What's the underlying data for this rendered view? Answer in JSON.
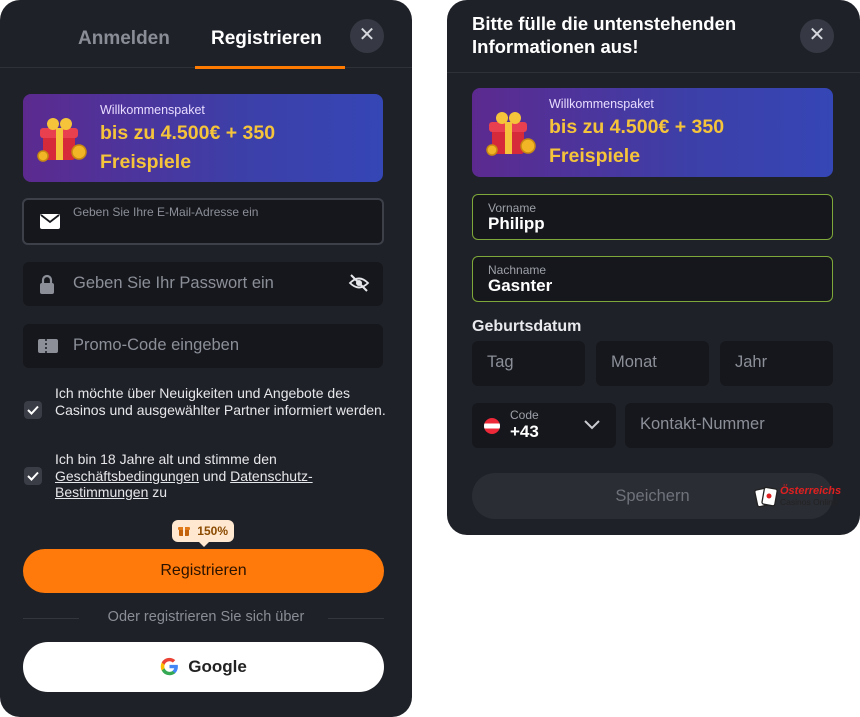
{
  "login_panel": {
    "tabs": {
      "login": "Anmelden",
      "register": "Registrieren"
    },
    "close": "✕",
    "promo": {
      "small": "Willkommenspaket",
      "big": "bis zu 4.500€ + 350 Freispiele"
    },
    "email": {
      "placeholder": "Geben Sie Ihre E-Mail-Adresse ein"
    },
    "password": {
      "placeholder": "Geben Sie Ihr Passwort ein"
    },
    "promo_code": {
      "placeholder": "Promo-Code eingeben"
    },
    "checkbox_news": {
      "label": "Ich möchte über Neuigkeiten und Angebote des Casinos und ausgewählter Partner informiert werden.",
      "checked": true
    },
    "checkbox_terms": {
      "prefix": "Ich bin 18 Jahre alt und stimme den ",
      "link1": "Geschäftsbedingungen",
      "middle": " und ",
      "link2": "Datenschutz-Bestimmungen",
      "suffix": " zu",
      "checked": true
    },
    "bonus_badge": "150%",
    "register_button": "Registrieren",
    "divider": "Oder registrieren Sie sich über",
    "google_button": "Google"
  },
  "details_panel": {
    "title": "Bitte fülle die untenstehenden Informationen aus!",
    "close": "✕",
    "promo": {
      "small": "Willkommenspaket",
      "big": "bis zu 4.500€ + 350 Freispiele"
    },
    "first_name": {
      "label": "Vorname",
      "value": "Philipp"
    },
    "last_name": {
      "label": "Nachname",
      "value": "Gasnter"
    },
    "birthdate": {
      "label": "Geburtsdatum",
      "day": "Tag",
      "month": "Monat",
      "year": "Jahr"
    },
    "phone": {
      "code_label": "Code",
      "code_value": "+43",
      "placeholder": "Kontakt-Nummer"
    },
    "save_button": "Speichern",
    "watermark": {
      "line1": "Österreichs",
      "line2": "Casinos Online"
    }
  },
  "colors": {
    "accent": "#ff7a0a",
    "panel": "#1f2128",
    "promo_gold": "#f5c43a",
    "valid_border": "#7fa83a"
  }
}
